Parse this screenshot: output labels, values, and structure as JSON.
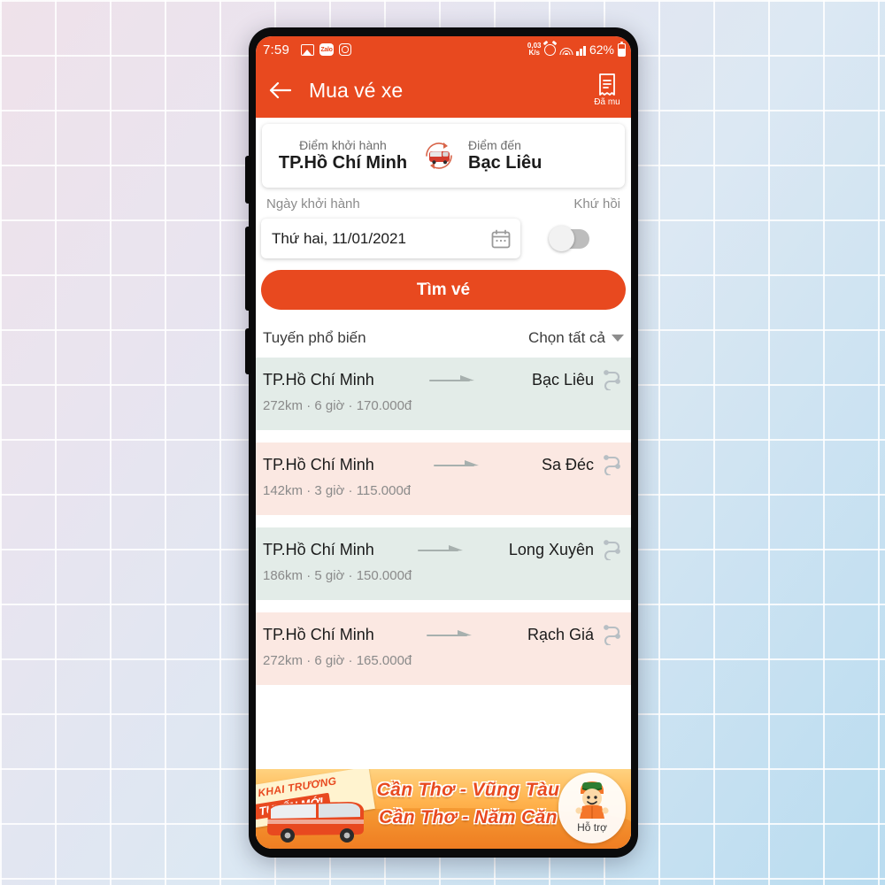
{
  "status_bar": {
    "time": "7:59",
    "left_icons": [
      "gallery-icon",
      "zalo-icon",
      "instagram-icon"
    ],
    "zalo_text": "Zalo",
    "net_speed_value": "0,03",
    "net_speed_unit": "K/s",
    "right_icons": [
      "alarm-icon",
      "wifi-icon",
      "signal-icon",
      "battery-icon"
    ],
    "battery": "62%"
  },
  "app_bar": {
    "back_icon": "back-arrow-icon",
    "title": "Mua vé xe",
    "purchased_icon": "receipt-icon",
    "purchased_label": "Đã mu"
  },
  "location_card": {
    "origin_label": "Điểm khởi hành",
    "origin_value": "TP.Hồ Chí Minh",
    "swap_icon": "bus-swap-icon",
    "destination_label": "Điểm đến",
    "destination_value": "Bạc Liêu"
  },
  "date_section": {
    "departure_label": "Ngày khởi hành",
    "round_trip_label": "Khứ hồi",
    "date_value": "Thứ hai, 11/01/2021",
    "calendar_icon": "calendar-icon",
    "round_trip_on": false
  },
  "search_button": {
    "label": "Tìm vé"
  },
  "routes_section": {
    "title": "Tuyến phổ biến",
    "select_all_label": "Chọn tất cả",
    "dropdown_icon": "chevron-down-icon",
    "rows": [
      {
        "from": "TP.Hồ Chí Minh",
        "to": "Bạc Liêu",
        "distance": "272km",
        "duration": "6 giờ",
        "price": "170.000đ",
        "meta": "272km  ·  6 giờ  ·  170.000đ",
        "tint": "green"
      },
      {
        "from": "TP.Hồ Chí Minh",
        "to": "Sa Đéc",
        "distance": "142km",
        "duration": "3 giờ",
        "price": "115.000đ",
        "meta": "142km  ·  3 giờ  ·  115.000đ",
        "tint": "pink"
      },
      {
        "from": "TP.Hồ Chí Minh",
        "to": "Long Xuyên",
        "distance": "186km",
        "duration": "5 giờ",
        "price": "150.000đ",
        "meta": "186km  ·  5 giờ  ·  150.000đ",
        "tint": "green"
      },
      {
        "from": "TP.Hồ Chí Minh",
        "to": "Rạch Giá",
        "distance": "272km",
        "duration": "6 giờ",
        "price": "165.000đ",
        "meta": "272km  ·  6 giờ  ·  165.000đ",
        "tint": "pink"
      }
    ]
  },
  "banner": {
    "ribbon_line1": "KHAI TRƯƠNG",
    "ribbon_line2": "TUYẾN MỚI",
    "route_line1": "Cần Thơ - Vũng Tàu",
    "route_line2": "Cần Thơ - Năm Căn",
    "support_label": "Hỗ trợ",
    "support_icon": "support-mascot-icon"
  },
  "colors": {
    "brand_orange": "#e8491f",
    "row_green": "#e3ece8",
    "row_pink": "#fbe8e2",
    "banner_orange": "#f9a13a"
  }
}
